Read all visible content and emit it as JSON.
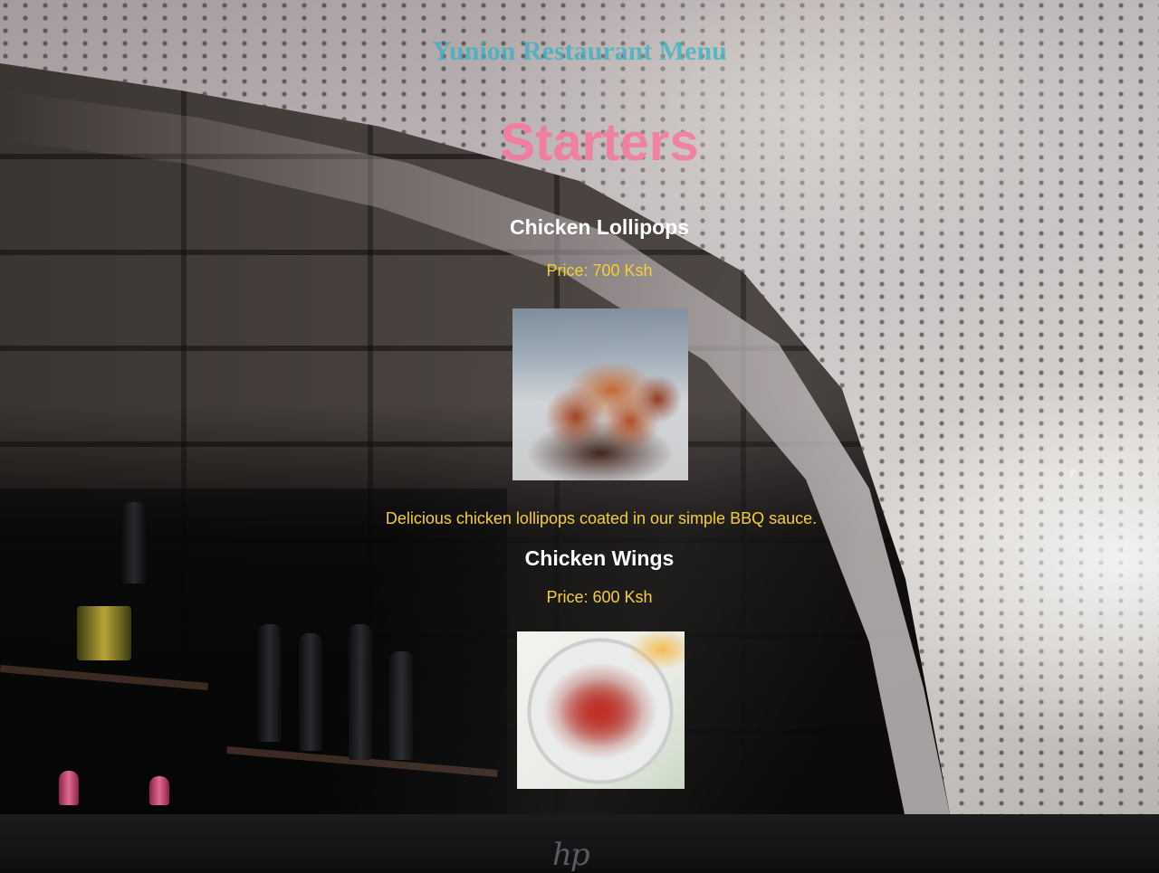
{
  "page": {
    "site_title": "Yunion Restaurant Menu",
    "section_title": "Starters"
  },
  "menu": {
    "items": [
      {
        "name": "Chicken Lollipops",
        "price": "Price: 700 Ksh",
        "image": "chicken-lollipops-photo",
        "description": "Delicious chicken lollipops coated in our simple BBQ sauce."
      },
      {
        "name": "Chicken Wings",
        "price": "Price: 600 Ksh",
        "image": "chicken-wings-photo"
      }
    ]
  },
  "colors": {
    "site_title": "#3bb2c4",
    "section_title": "#f07ea0",
    "item_name": "#ffffff",
    "price_and_description": "#f2cf2a"
  },
  "icons": {
    "mouse_cursor": "pointer-cursor-icon",
    "laptop_brand": "hp-logo-icon"
  }
}
